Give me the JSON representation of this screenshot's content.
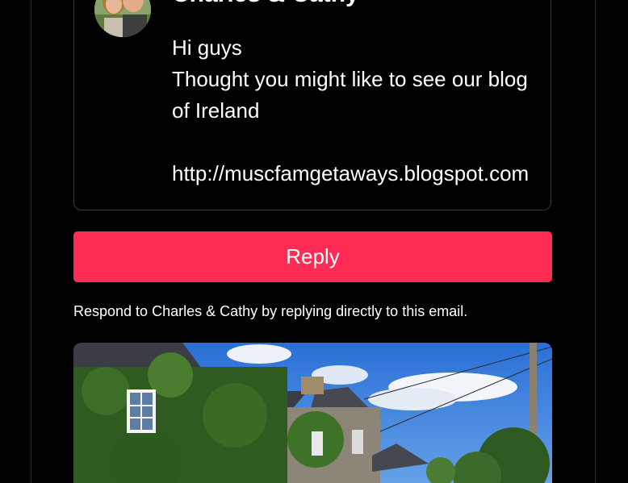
{
  "sender": {
    "name": "Charles & Cathy"
  },
  "message": {
    "greeting": "Hi guys",
    "line1": "Thought you might like to see our blog",
    "line2": "of Ireland",
    "link": "http://muscfamgetaways.blogspot.com"
  },
  "actions": {
    "reply_label": "Reply"
  },
  "footer": {
    "respond_note": "Respond to Charles & Cathy by replying directly to this email."
  },
  "colors": {
    "background": "#000000",
    "reply_button": "#fe2c55",
    "text": "#ffffff"
  }
}
